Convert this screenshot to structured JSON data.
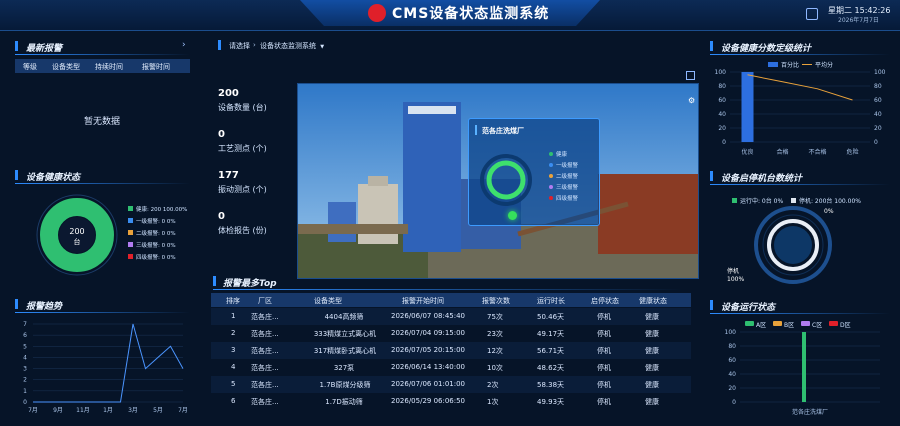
{
  "header": {
    "title": "CMS设备状态监测系统",
    "weekday_time": "星期二 15:42:26",
    "date": "2026年7月7日"
  },
  "alarms": {
    "title": "最新报警",
    "columns": [
      "等级",
      "设备类型",
      "持续时间",
      "报警时间"
    ],
    "empty": "暂无数据"
  },
  "health": {
    "title": "设备健康状态",
    "center_value": "200",
    "center_unit": "台",
    "legend": [
      {
        "label": "健康: 200 100.00%",
        "color": "#2fbf71"
      },
      {
        "label": "一级报警: 0 0%",
        "color": "#3a8df0"
      },
      {
        "label": "二级报警: 0 0%",
        "color": "#e9a23b"
      },
      {
        "label": "三级报警: 0 0%",
        "color": "#b07cf0"
      },
      {
        "label": "四级报警: 0 0%",
        "color": "#e0202a"
      }
    ]
  },
  "trend": {
    "title": "报警趋势",
    "y_ticks": [
      "7",
      "6",
      "5",
      "4",
      "3",
      "2",
      "1",
      "0"
    ],
    "x_ticks": [
      "7月",
      "9月",
      "11月",
      "1月",
      "3月",
      "5月",
      "7月"
    ]
  },
  "selector": {
    "prompt": "请选择",
    "value": "设备状态监测系统"
  },
  "stats": [
    {
      "value": "200",
      "label": "设备数量 (台)"
    },
    {
      "value": "0",
      "label": "工艺测点 (个)"
    },
    {
      "value": "177",
      "label": "振动测点 (个)"
    },
    {
      "value": "0",
      "label": "体检报告 (份)"
    }
  ],
  "plant": {
    "name": "范各庄洗煤厂",
    "legend": [
      {
        "label": "健康",
        "color": "#2fbf71"
      },
      {
        "label": "一级报警",
        "color": "#3a8df0"
      },
      {
        "label": "二级报警",
        "color": "#e9a23b"
      },
      {
        "label": "三级报警",
        "color": "#b07cf0"
      },
      {
        "label": "四级报警",
        "color": "#e0202a"
      }
    ]
  },
  "top": {
    "title": "报警最多Top",
    "columns": [
      "排序",
      "厂区",
      "设备类型",
      "报警开始时间",
      "报警次数",
      "运行时长",
      "启停状态",
      "健康状态"
    ],
    "rows": [
      [
        "1",
        "范各庄...",
        "4404高频筛",
        "2026/06/07 08:45:40",
        "75次",
        "50.46天",
        "停机",
        "健康"
      ],
      [
        "2",
        "范各庄...",
        "333精煤立式离心机",
        "2026/07/04 09:15:00",
        "23次",
        "49.17天",
        "停机",
        "健康"
      ],
      [
        "3",
        "范各庄...",
        "317精煤卧式离心机",
        "2026/07/05 20:15:00",
        "12次",
        "56.71天",
        "停机",
        "健康"
      ],
      [
        "4",
        "范各庄...",
        "327泵",
        "2026/06/14 13:40:00",
        "10次",
        "48.62天",
        "停机",
        "健康"
      ],
      [
        "5",
        "范各庄...",
        "1.7B原煤分级筛",
        "2026/07/06 01:01:00",
        "2次",
        "58.38天",
        "停机",
        "健康"
      ],
      [
        "6",
        "范各庄...",
        "1.7D振动筛",
        "2026/05/29 06:06:50",
        "1次",
        "49.93天",
        "停机",
        "健康"
      ]
    ]
  },
  "grade": {
    "title": "设备健康分数定级统计",
    "legend": [
      "百分比",
      "平均分"
    ],
    "y_left": [
      "100",
      "80",
      "60",
      "40",
      "20",
      "0"
    ],
    "y_right": [
      "100",
      "80",
      "60",
      "40",
      "20",
      "0"
    ],
    "categories": [
      "优良",
      "合格",
      "不合格",
      "危险"
    ]
  },
  "runstop": {
    "title": "设备启停机台数统计",
    "legend_run": "运行中: 0台 0%",
    "legend_stop": "停机: 200台 100.00%",
    "label_top": "0%",
    "label_bottom_a": "停机",
    "label_bottom_b": "100%"
  },
  "area": {
    "title": "设备运行状态",
    "legend": [
      {
        "label": "A区",
        "color": "#2fbf71"
      },
      {
        "label": "B区",
        "color": "#e9a23b"
      },
      {
        "label": "C区",
        "color": "#b07cf0"
      },
      {
        "label": "D区",
        "color": "#e0202a"
      }
    ],
    "y_ticks": [
      "100",
      "80",
      "60",
      "40",
      "20",
      "0"
    ],
    "category": "范各庄洗煤厂"
  },
  "chart_data": [
    {
      "type": "line",
      "title": "报警趋势",
      "x": [
        "7月",
        "8月",
        "9月",
        "10月",
        "11月",
        "12月",
        "1月",
        "2月",
        "3月",
        "4月",
        "5月",
        "6月",
        "7月"
      ],
      "values": [
        0,
        0,
        0,
        0,
        0,
        0,
        0,
        0,
        7,
        3,
        4,
        5,
        3
      ],
      "ylim": [
        0,
        7
      ]
    },
    {
      "type": "bar",
      "title": "设备健康分数定级统计",
      "categories": [
        "优良",
        "合格",
        "不合格",
        "危险"
      ],
      "series": [
        {
          "name": "百分比",
          "values": [
            100,
            0,
            0,
            0
          ]
        },
        {
          "name": "平均分",
          "values": [
            96,
            86,
            76,
            60
          ]
        }
      ],
      "ylim": [
        0,
        100
      ]
    },
    {
      "type": "bar",
      "title": "设备运行状态",
      "categories": [
        "范各庄洗煤厂"
      ],
      "series": [
        {
          "name": "A区",
          "values": [
            100
          ]
        },
        {
          "name": "B区",
          "values": [
            0
          ]
        },
        {
          "name": "C区",
          "values": [
            0
          ]
        },
        {
          "name": "D区",
          "values": [
            0
          ]
        }
      ],
      "ylim": [
        0,
        100
      ]
    },
    {
      "type": "pie",
      "title": "设备健康状态",
      "categories": [
        "健康",
        "一级报警",
        "二级报警",
        "三级报警",
        "四级报警"
      ],
      "values": [
        200,
        0,
        0,
        0,
        0
      ]
    }
  ]
}
